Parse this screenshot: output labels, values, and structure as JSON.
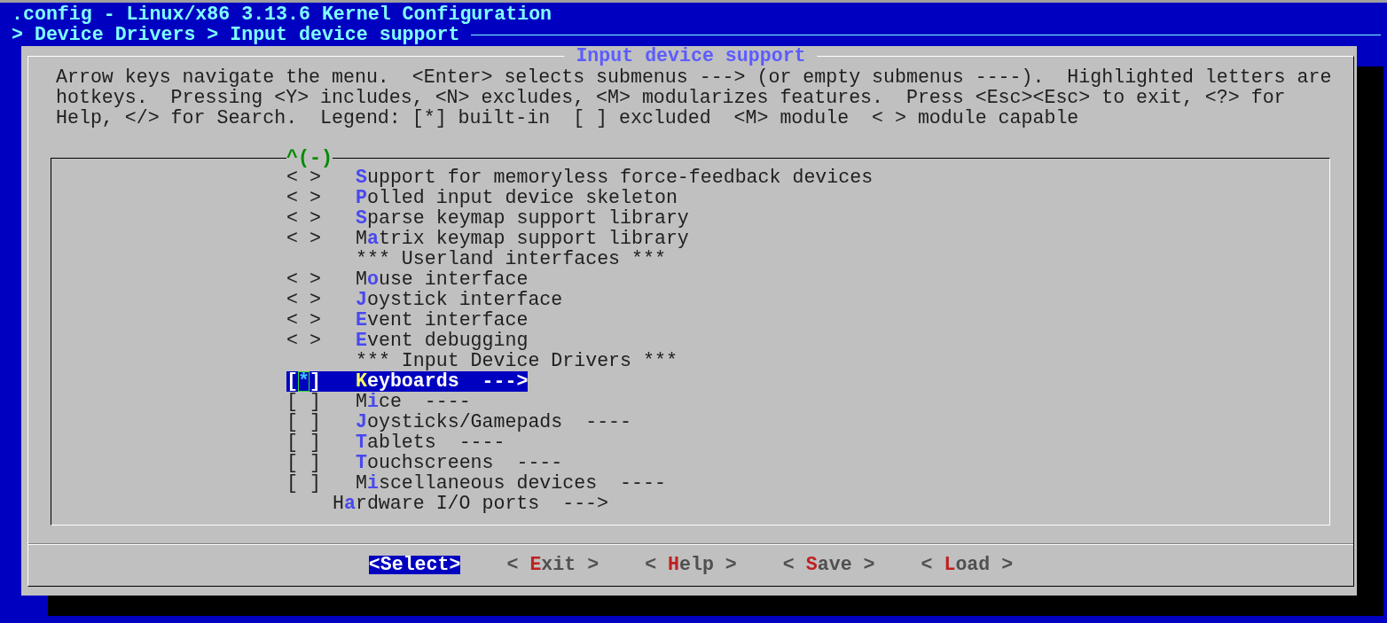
{
  "title": ".config - Linux/x86 3.13.6 Kernel Configuration",
  "breadcrumb": "> Device Drivers > Input device support",
  "dialog": {
    "title": "Input device support",
    "help": "Arrow keys navigate the menu.  <Enter> selects submenus ---> (or empty submenus ----).  Highlighted letters are\nhotkeys.  Pressing <Y> includes, <N> excludes, <M> modularizes features.  Press <Esc><Esc> to exit, <?> for\nHelp, </> for Search.  Legend: [*] built-in  [ ] excluded  <M> module  < > module capable",
    "scroll_indicator": "^(-)",
    "items": [
      {
        "kind": "option",
        "prompt": "< >",
        "label": "**S**upport for memoryless force-feedback devices",
        "selected": false
      },
      {
        "kind": "option",
        "prompt": "< >",
        "label": "**P**olled input device skeleton",
        "selected": false
      },
      {
        "kind": "option",
        "prompt": "< >",
        "label": "**S**parse keymap support library",
        "selected": false
      },
      {
        "kind": "option",
        "prompt": "< >",
        "label": "M**a**trix keymap support library",
        "selected": false
      },
      {
        "kind": "comment",
        "label": "*** Userland interfaces ***"
      },
      {
        "kind": "option",
        "prompt": "< >",
        "label": "M**o**use interface",
        "selected": false
      },
      {
        "kind": "option",
        "prompt": "< >",
        "label": "**J**oystick interface",
        "selected": false
      },
      {
        "kind": "option",
        "prompt": "< >",
        "label": "**E**vent interface",
        "selected": false
      },
      {
        "kind": "option",
        "prompt": "< >",
        "label": "**E**vent debugging",
        "selected": false
      },
      {
        "kind": "comment",
        "label": "*** Input Device Drivers ***"
      },
      {
        "kind": "option",
        "prompt": "[*]",
        "label": "**K**eyboards  --->",
        "selected": true
      },
      {
        "kind": "option",
        "prompt": "[ ]",
        "label": "M**i**ce  ----",
        "selected": false
      },
      {
        "kind": "option",
        "prompt": "[ ]",
        "label": "**J**oysticks/Gamepads  ----",
        "selected": false
      },
      {
        "kind": "option",
        "prompt": "[ ]",
        "label": "**T**ablets  ----",
        "selected": false
      },
      {
        "kind": "option",
        "prompt": "[ ]",
        "label": "**T**ouchscreens  ----",
        "selected": false
      },
      {
        "kind": "option",
        "prompt": "[ ]",
        "label": "M**i**scellaneous devices  ----",
        "selected": false
      },
      {
        "kind": "menu",
        "label": "H**a**rdware I/O ports  --->",
        "selected": false
      }
    ]
  },
  "buttons": [
    {
      "label": "<Select>",
      "selected": true
    },
    {
      "label": "< **E**xit >",
      "selected": false
    },
    {
      "label": "< **H**elp >",
      "selected": false
    },
    {
      "label": "< **S**ave >",
      "selected": false
    },
    {
      "label": "< **L**oad >",
      "selected": false
    }
  ]
}
